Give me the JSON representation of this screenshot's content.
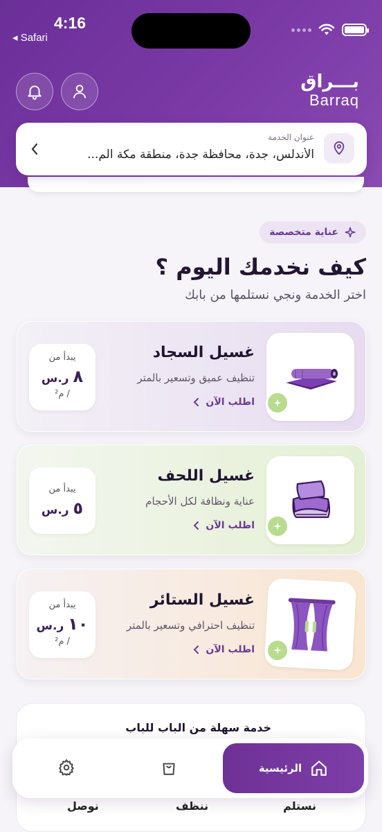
{
  "status_bar": {
    "time": "4:16",
    "back_app": "◂ Safari"
  },
  "brand": {
    "logo_ar": "بـــراق",
    "logo_en": "Barraq"
  },
  "address": {
    "label": "عنوان الخدمة",
    "value": "الأندلس، جدة، محافظة جدة، منطقة مكة الم..."
  },
  "badge": "عناية متخصصة",
  "headline": "كيف نخدمك اليوم ؟",
  "subheadline": "اختر الخدمة ونجي نستلمها من بابك",
  "services": [
    {
      "title": "غسيل السجاد",
      "description": "تنظيف عميق وتسعير بالمتر",
      "cta": "اطلب الآن",
      "price_from": "يبدأ من",
      "price_value": "٨",
      "currency": "ر.س",
      "unit": "/ م²",
      "image_icon": "carpet-icon"
    },
    {
      "title": "غسيل اللحف",
      "description": "عناية ونظافة لكل الأحجام",
      "cta": "اطلب الآن",
      "price_from": "يبدأ من",
      "price_value": "٥",
      "currency": "ر.س",
      "unit": "",
      "image_icon": "blanket-icon"
    },
    {
      "title": "غسيل الستائر",
      "description": "تنظيف احترافي وتسعير بالمتر",
      "cta": "اطلب الآن",
      "price_from": "يبدأ من",
      "price_value": "١٠",
      "currency": "ر.س",
      "unit": "/ م²",
      "image_icon": "curtain-icon"
    }
  ],
  "info": {
    "title": "خدمة سهلة من الباب للباب",
    "steps": [
      "نستلم",
      "ننظف",
      "نوصل"
    ]
  },
  "nav": {
    "home_label": "الرئيسية"
  },
  "colors": {
    "brand": "#6b2f98",
    "accent_green": "#b8dc8e",
    "cta": "#6b3a94"
  }
}
